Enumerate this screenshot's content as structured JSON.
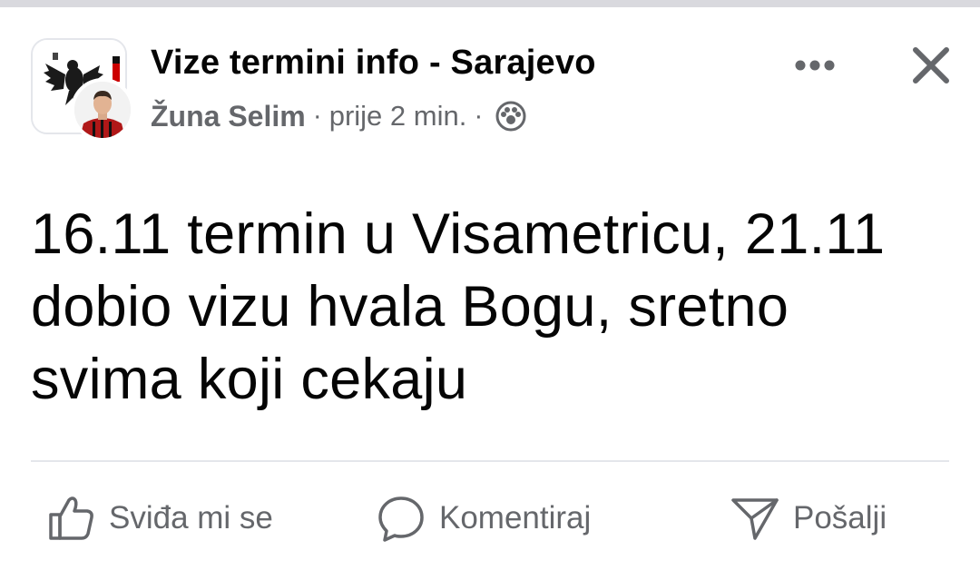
{
  "post": {
    "group_name": "Vize termini info - Sarajevo",
    "author": "Žuna Selim",
    "separator": "·",
    "time": "prije 2 min.",
    "audience_icon": "group-audience-icon",
    "body": "16.11 termin u Visametricu, 21.11 dobio vizu hvala Bogu, sretno svima koji cekaju"
  },
  "header": {
    "more_icon": "more-horizontal-icon",
    "close_icon": "close-icon"
  },
  "actions": [
    {
      "label": "Sviđa mi se",
      "icon": "thumbs-up-icon"
    },
    {
      "label": "Komentiraj",
      "icon": "comment-bubble-icon"
    },
    {
      "label": "Pošalji",
      "icon": "send-icon"
    }
  ],
  "colors": {
    "text_primary": "#050505",
    "text_secondary": "#65676b",
    "divider": "#e4e6eb",
    "top_strip": "#d9d9de"
  }
}
